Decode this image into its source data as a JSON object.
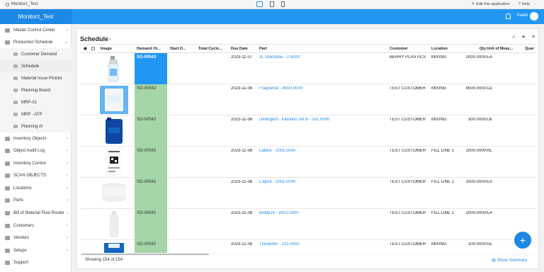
{
  "browser": {
    "app_title": "Monitorz_Test",
    "edit_label": "Edit this application",
    "help_label": "Help"
  },
  "header": {
    "brand": "Monitorz_Test",
    "user_name": "Kaleb"
  },
  "sidebar": {
    "items": [
      {
        "label": "Master Control Center"
      },
      {
        "label": "Production Schedule"
      },
      {
        "label": "Customer Demand"
      },
      {
        "label": "Schedule"
      },
      {
        "label": "Material Issue Picklist"
      },
      {
        "label": "Planning Board"
      },
      {
        "label": "MRP-01"
      },
      {
        "label": "MRP - ATP"
      },
      {
        "label": "Planning AI"
      },
      {
        "label": "Inventory Objects"
      },
      {
        "label": "Object Audit Log"
      },
      {
        "label": "Inventory Control"
      },
      {
        "label": "SCAN OBJECTS"
      },
      {
        "label": "Locations"
      },
      {
        "label": "Parts"
      },
      {
        "label": "Bill of Material Flow Router"
      },
      {
        "label": "Customers"
      },
      {
        "label": "Vendors"
      },
      {
        "label": "Setups"
      },
      {
        "label": "Support"
      }
    ]
  },
  "page": {
    "title": "Schedule",
    "count_text": "Showing 154 of 154",
    "summary_link": "Show Summary"
  },
  "table": {
    "headers": {
      "image": "Image",
      "demand_order": "Demand Or...",
      "start": "Start D...",
      "total_cycle": "Total Cycle...",
      "due_date": "Due Date",
      "part": "Part",
      "customer": "Customer",
      "location": "Location",
      "qty": "Qty",
      "uom": "Unit of Meas...",
      "quar": "Quar"
    },
    "rows": [
      {
        "so": "SO-00543",
        "due": "2023-11-07",
        "part": "JL Shampoo - 2.0000",
        "customer": "BERRY PLASTICS",
        "location": "MIXING",
        "qty": "2000.0000",
        "uom": "EA"
      },
      {
        "so": "SO-00542",
        "due": "2023-11-08",
        "part": "Fragrance - 8000.0000",
        "customer": "TEST CUSTOMER",
        "location": "MIXING",
        "qty": "8000.0000",
        "uom": "OZ"
      },
      {
        "so": "SO-00542",
        "due": "2023-11-08",
        "part": "Detergent - Kieralon Jet B - 501.0000",
        "customer": "TEST CUSTOMER",
        "location": "MIXING",
        "qty": "500.0000",
        "uom": "LB"
      },
      {
        "so": "SO-00542",
        "due": "2023-11-08",
        "part": "Labels - 2001.0000",
        "customer": "TEST CUSTOMER",
        "location": "FILL LINE 1",
        "qty": "2000.0000",
        "uom": "RL"
      },
      {
        "so": "SO-00542",
        "due": "2023-11-08",
        "part": "Cap28 - 2001.0000",
        "customer": "TEST CUSTOMER",
        "location": "FILL LINE 1",
        "qty": "2000.0000",
        "uom": "EA"
      },
      {
        "so": "SO-00542",
        "due": "2023-11-08",
        "part": "Bottle16 - 2001.0000",
        "customer": "TEST CUSTOMER",
        "location": "FILL LINE 1",
        "qty": "2000.0000",
        "uom": "EA"
      },
      {
        "so": "SO-00542",
        "due": "2023-11-08",
        "part": "Thickener - 101.0000",
        "customer": "TEST CUSTOMER",
        "location": "MIXING",
        "qty": "100.0000",
        "uom": "GL"
      }
    ]
  },
  "fab": {
    "label": "+"
  },
  "colors": {
    "accent": "#2196f3",
    "selected_row": "#2196f3",
    "order_cell": "#a5d6a7"
  }
}
